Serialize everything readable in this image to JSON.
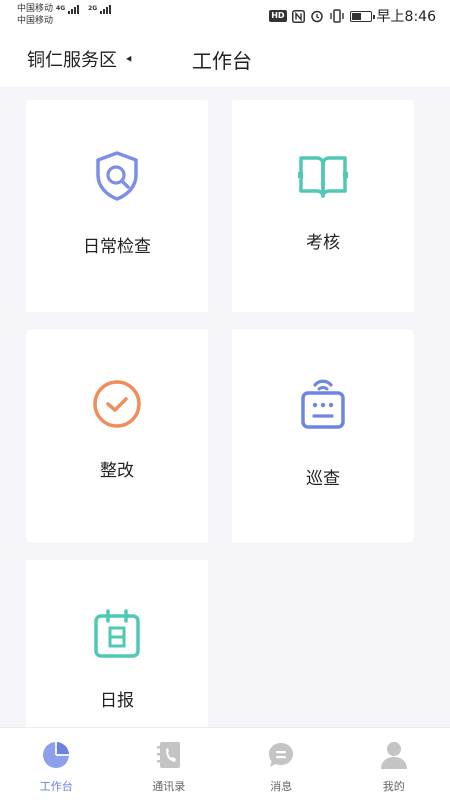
{
  "status_bar": {
    "carrier1": "中国移动",
    "carrier2": "中国移动",
    "net1": "4G",
    "net2": "2G",
    "hd": "HD",
    "time": "早上8:46"
  },
  "header": {
    "area": "铜仁服务区",
    "title": "工作台"
  },
  "cards": [
    {
      "label": "日常检查",
      "icon": "shield-search-icon",
      "color": "#7c8fe6"
    },
    {
      "label": "考核",
      "icon": "open-book-icon",
      "color": "#4fc8b4"
    },
    {
      "label": "整改",
      "icon": "check-circle-icon",
      "color": "#ef8d5b"
    },
    {
      "label": "巡查",
      "icon": "robot-icon",
      "color": "#6e86e3"
    },
    {
      "label": "日报",
      "icon": "calendar-icon",
      "color": "#4fc8b4"
    }
  ],
  "tabs": [
    {
      "label": "工作台",
      "icon": "pie-chart-icon",
      "active": true
    },
    {
      "label": "通讯录",
      "icon": "phone-book-icon",
      "active": false
    },
    {
      "label": "消息",
      "icon": "message-bubble-icon",
      "active": false
    },
    {
      "label": "我的",
      "icon": "person-icon",
      "active": false
    }
  ],
  "colors": {
    "accent": "#6b82e0",
    "inactive_tab": "#bcbcbc",
    "background": "#f6f6fa"
  }
}
